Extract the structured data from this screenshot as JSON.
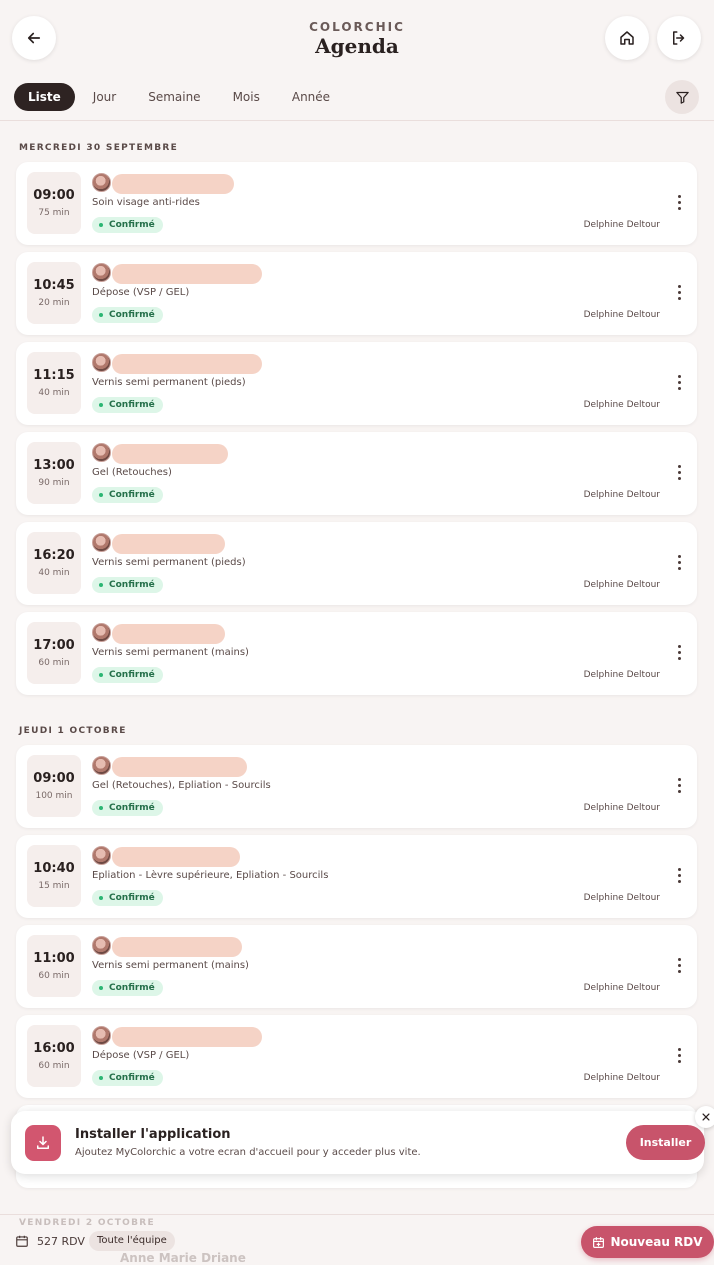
{
  "header": {
    "brand": "COLORCHIC",
    "title": "Agenda"
  },
  "tabs": [
    {
      "label": "Liste",
      "active": true
    },
    {
      "label": "Jour",
      "active": false
    },
    {
      "label": "Semaine",
      "active": false
    },
    {
      "label": "Mois",
      "active": false
    },
    {
      "label": "Année",
      "active": false
    }
  ],
  "days": [
    {
      "label": "MERCREDI 30 SEPTEMBRE",
      "appointments": [
        {
          "time": "09:00",
          "duration": "75 min",
          "service": "Soin visage anti-rides",
          "status": "Confirmé",
          "staff": "Delphine Deltour"
        },
        {
          "time": "10:45",
          "duration": "20 min",
          "service": "Dépose (VSP / GEL)",
          "status": "Confirmé",
          "staff": "Delphine Deltour"
        },
        {
          "time": "11:15",
          "duration": "40 min",
          "service": "Vernis semi permanent (pieds)",
          "status": "Confirmé",
          "staff": "Delphine Deltour"
        },
        {
          "time": "13:00",
          "duration": "90 min",
          "service": "Gel (Retouches)",
          "status": "Confirmé",
          "staff": "Delphine Deltour"
        },
        {
          "time": "16:20",
          "duration": "40 min",
          "service": "Vernis semi permanent (pieds)",
          "status": "Confirmé",
          "staff": "Delphine Deltour"
        },
        {
          "time": "17:00",
          "duration": "60 min",
          "service": "Vernis semi permanent (mains)",
          "status": "Confirmé",
          "staff": "Delphine Deltour"
        }
      ]
    },
    {
      "label": "JEUDI 1 OCTOBRE",
      "appointments": [
        {
          "time": "09:00",
          "duration": "100 min",
          "service": "Gel (Retouches), Epliation - Sourcils",
          "status": "Confirmé",
          "staff": "Delphine Deltour"
        },
        {
          "time": "10:40",
          "duration": "15 min",
          "service": "Epliation - Lèvre supérieure, Epliation - Sourcils",
          "status": "Confirmé",
          "staff": "Delphine Deltour"
        },
        {
          "time": "11:00",
          "duration": "60 min",
          "service": "Vernis semi permanent (mains)",
          "status": "Confirmé",
          "staff": "Delphine Deltour"
        },
        {
          "time": "16:00",
          "duration": "60 min",
          "service": "Dépose (VSP / GEL)",
          "status": "Confirmé",
          "staff": "Delphine Deltour"
        }
      ]
    }
  ],
  "next_day_label": "VENDREDI 2 OCTOBRE",
  "next_client_name": "Anne Marie Driane",
  "install_banner": {
    "title": "Installer l'application",
    "subtitle": "Ajoutez MyColorchic a votre ecran d'accueil pour y acceder plus vite.",
    "button": "Installer"
  },
  "footer": {
    "rdv_count": "527 RDV",
    "team_filter": "Toute l'équipe",
    "new_button": "Nouveau RDV"
  },
  "colors": {
    "background": "#f8f4f3",
    "accent": "#c8546b",
    "dark": "#2e2322",
    "confirmed_bg": "#ddf6e8",
    "confirmed_dot": "#2bb673"
  }
}
